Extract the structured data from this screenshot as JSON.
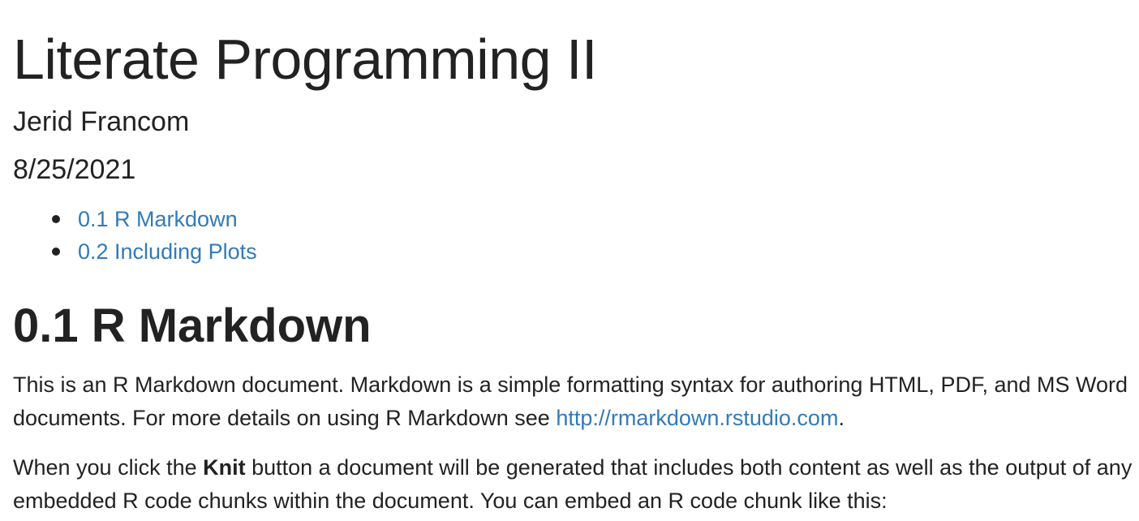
{
  "document": {
    "title": "Literate Programming II",
    "author": "Jerid Francom",
    "date": "8/25/2021"
  },
  "toc": {
    "items": [
      {
        "label": "0.1 R Markdown"
      },
      {
        "label": "0.2 Including Plots"
      }
    ]
  },
  "section": {
    "heading": "0.1 R Markdown",
    "paragraph1": {
      "text_before_link": "This is an R Markdown document. Markdown is a simple formatting syntax for authoring HTML, PDF, and MS Word documents. For more details on using R Markdown see ",
      "link_text": "http://rmarkdown.rstudio.com",
      "text_after_link": "."
    },
    "paragraph2": {
      "text_before_bold": "When you click the ",
      "bold_text": "Knit",
      "text_after_bold": " button a document will be generated that includes both content as well as the output of any embedded R code chunks within the document. You can embed an R code chunk like this:"
    }
  },
  "colors": {
    "text": "#222222",
    "link": "#337ab7",
    "background": "#ffffff"
  }
}
